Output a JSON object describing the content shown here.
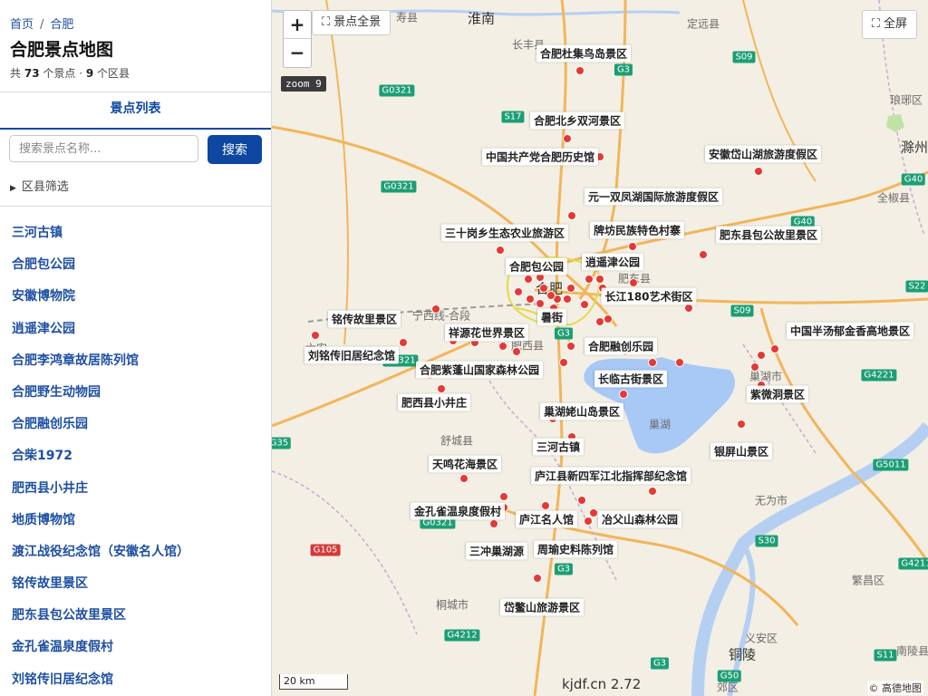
{
  "breadcrumb": {
    "home": "首页",
    "separator": "/",
    "current": "合肥"
  },
  "page": {
    "title": "合肥景点地图",
    "stats_prefix": "共",
    "spot_count": "73",
    "spot_unit": "个景点 ·",
    "district_count": "9",
    "district_unit": "个区县"
  },
  "tabs": {
    "spot_list": "景点列表"
  },
  "search": {
    "placeholder": "搜索景点名称...",
    "button": "搜索"
  },
  "filter": {
    "label": "区县筛选"
  },
  "spots": [
    "三河古镇",
    "合肥包公园",
    "安徽博物院",
    "逍遥津公园",
    "合肥李鸿章故居陈列馆",
    "合肥野生动物园",
    "合肥融创乐园",
    "合柴1972",
    "肥西县小井庄",
    "地质博物馆",
    "渡江战役纪念馆（安徽名人馆）",
    "铭传故里景区",
    "肥东县包公故里景区",
    "金孔雀温泉度假村",
    "刘铭传旧居纪念馆"
  ],
  "map": {
    "zoom_in": "+",
    "zoom_out": "−",
    "zoom_label": "zoom 9",
    "overview_btn": "景点全景",
    "fullscreen_btn": "全屏",
    "scale": "20 km",
    "watermark": "kjdf.cn 2.72",
    "attribution": "© 高德地图",
    "colors": {
      "marker": "#e53935",
      "lake": "#a8c8f5",
      "expressway": "#f3b55a",
      "highway_shield": "#1c9e74",
      "national_road_shield": "#d33a3a"
    },
    "labels": [
      "合肥杜集鸟岛景区",
      "合肥北乡双河景区",
      "中国共产党合肥历史馆",
      "安徽岱山湖旅游度假区",
      "元一双凤湖国际旅游度假区",
      "三十岗乡生态农业旅游区",
      "牌坊民族特色村寨",
      "肥东县包公故里景区",
      "合肥包公园",
      "逍遥津公园",
      "长江180艺术街区",
      "铭传故里景区",
      "暑街",
      "中国半汤郁金香高地景区",
      "祥源花世界景区",
      "合肥融创乐园",
      "刘铭传旧居纪念馆",
      "合肥紫蓬山国家森林公园",
      "长临古街景区",
      "紫微洞景区",
      "肥西县小井庄",
      "巢湖姥山岛景区",
      "三河古镇",
      "银屏山景区",
      "天鸣花海景区",
      "庐江县新四军江北指挥部纪念馆",
      "金孔雀温泉度假村",
      "庐江名人馆",
      "冶父山森林公园",
      "三冲巢湖源",
      "周瑜史料陈列馆",
      "岱鳖山旅游景区"
    ],
    "places": [
      "淮南",
      "寿县",
      "长丰县",
      "定远县",
      "滁州",
      "琅琊区",
      "全椒县",
      "肥东县",
      "合肥",
      "巢湖市",
      "巢湖",
      "舒城县",
      "肥西县",
      "无为市",
      "铜陵",
      "繁昌区",
      "南陵县",
      "桐城市",
      "义安区",
      "郊区",
      "宁西线-合段",
      "六安"
    ],
    "shields": [
      "S09",
      "G3",
      "G0321",
      "S17",
      "G0321",
      "G40",
      "G40",
      "S22",
      "S09",
      "G3",
      "G0321",
      "G4221",
      "G35",
      "G5011",
      "G0321",
      "G105",
      "S30",
      "G3",
      "G4212",
      "G3",
      "G4211",
      "G50",
      "S11"
    ]
  }
}
